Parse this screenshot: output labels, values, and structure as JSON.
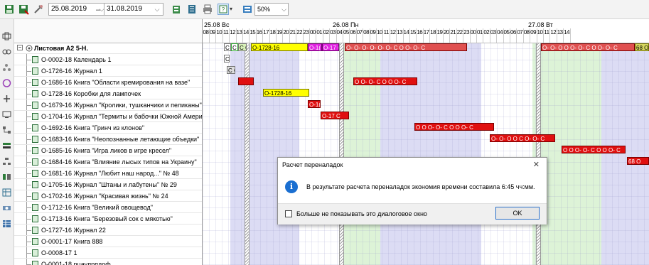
{
  "toolbar": {
    "date_from": "25.08.2019",
    "date_to": "31.08.2019",
    "zoom": "50%",
    "dash": "–"
  },
  "tree": {
    "root_label": "Листовая А2 5-Н.",
    "rows": [
      "О-0002-18 Календарь 1",
      "О-1726-16 Журнал 1",
      "О-1686-16 Книга \"Области кремирования на вазе\"",
      "О-1728-16 Коробки для лампочек",
      "О-1679-16 Журнал \"Кролики, тушканчики и пеликаны\" №",
      "О-1704-16 Журнал \"Термиты и бабочки Южной Америки\" N",
      "О-1692-16 Книга \"Гринч из клонов\"",
      "О-1683-16 Книга \"Неопознанные летающие объедки\"",
      "О-1685-16 Книга \"Игра ликов в игре кресел\"",
      "О-1684-16 Книга \"Влияние лысых типов на Украину\"",
      "О-1681-16 Журнал \"Любит наш народ...\" № 48",
      "О-1705-16 Журнал \"Штаны и лабутены\" № 29",
      "О-1702-16 Журнал \"Красивая жизнь\" № 24",
      "О-1712-16 Книга \"Великий овощевод\"",
      "О-1713-16 Книга \"Березовый сок с мякотью\"",
      "О-1727-16 Журнал 22",
      "О-0001-17 Книга 888",
      "О-0008-17 1",
      "О-0001-18 рцаулрпдоф"
    ]
  },
  "gantt": {
    "days": [
      "25.08 Вс",
      "26.08 Пн",
      "27.08 Вт"
    ],
    "hours_day1": [
      "08",
      "09",
      "10",
      "11",
      "12",
      "13",
      "14",
      "15",
      "16",
      "17",
      "18",
      "19",
      "20",
      "21",
      "22",
      "23"
    ],
    "hours_day2": [
      "00",
      "01",
      "02",
      "03",
      "04",
      "05",
      "06",
      "07",
      "08",
      "09",
      "10",
      "11",
      "12",
      "13",
      "14",
      "15",
      "16",
      "17",
      "18",
      "19",
      "20",
      "21",
      "22",
      "23"
    ],
    "hours_day3": [
      "00",
      "01",
      "02",
      "03",
      "04",
      "05",
      "06",
      "07",
      "08",
      "09",
      "10",
      "11",
      "12",
      "13",
      "14"
    ],
    "bar_labels": {
      "top_yellow": "О-1728-16",
      "row4_yellow": "О-1728-16",
      "row5": "О-1(",
      "row6": "О-17 С",
      "row3_chain": "О О- О- С О О О- С",
      "row7_chain": "О О О- О- С О О О- С",
      "row8_chain": "О- О- О О С О- О- С",
      "row9_chain": "О О О- О- С О О О- С",
      "row10_end": "68 О",
      "top_chain": "О- О- О- О- О- О- С О О- О- С",
      "top_chain2": "О- О- О О О- О- С О О- О- С",
      "top_end": "68 О",
      "cc": "С С"
    }
  },
  "dialog": {
    "title": "Расчет переналадок",
    "message": "В результате расчета переналадок экономия времени составила 6:45 чч:мм.",
    "checkbox_label": "Больше не показывать это диалоговое окно",
    "ok_label": "OK"
  }
}
